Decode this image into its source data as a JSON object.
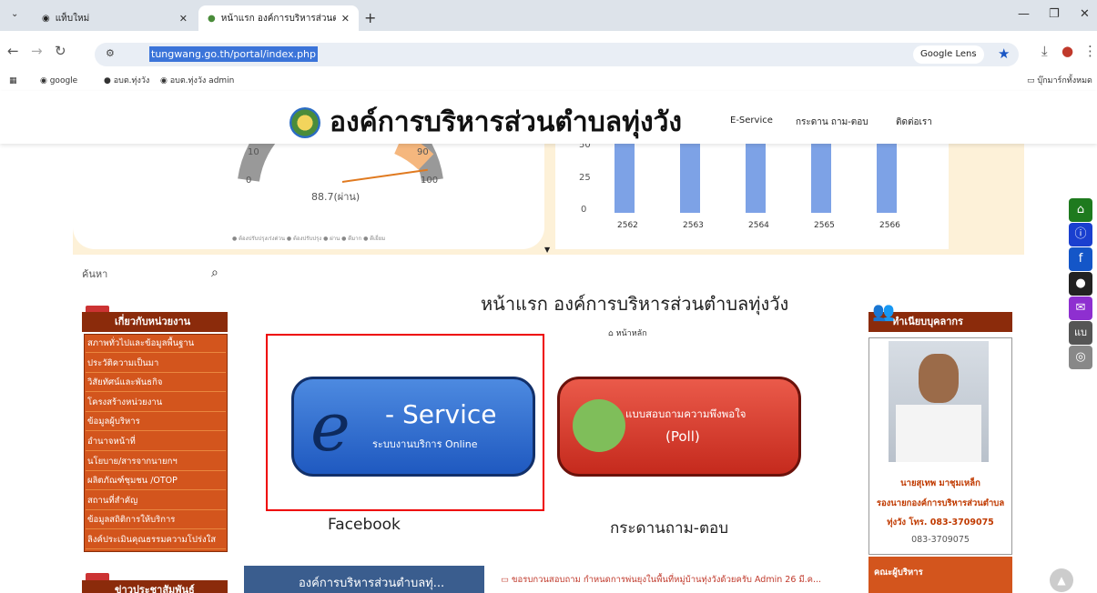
{
  "browser": {
    "tabs": [
      {
        "title": "แท็บใหม่"
      },
      {
        "title": "หน้าแรก องค์การบริหารส่วนตำบลทุ่ง"
      }
    ],
    "url": "tungwang.go.th/portal/index.php",
    "lens_label": "Google Lens",
    "bookmarks": [
      "google",
      "อบต.ทุ่งวัง",
      "อบต.ทุ่งวัง admin"
    ],
    "all_bookmarks": "บุ๊กมาร์กทั้งหมด"
  },
  "header": {
    "site_name": "องค์การบริหารส่วนตำบลทุ่งวัง",
    "menu": [
      "E-Service",
      "กระดาน ถาม-ตอบ",
      "ติดต่อเรา"
    ]
  },
  "gauge": {
    "ticks": [
      "10",
      "90",
      "0",
      "100"
    ],
    "value_label": "88.7(ผ่าน)",
    "value": 88.7,
    "legend": "● ต้องปรับปรุงเร่งด่วน  ● ต้องปรับปรุง  ● ผ่าน  ● ดีมาก  ● ดีเยี่ยม"
  },
  "chart_data": {
    "type": "bar",
    "categories": [
      "2562",
      "2563",
      "2564",
      "2565",
      "2566"
    ],
    "yticks": [
      "0",
      "25",
      "50"
    ],
    "values": [
      80,
      80,
      80,
      80,
      80
    ],
    "ylim": [
      0,
      50
    ]
  },
  "search": {
    "placeholder": "ค้นหา"
  },
  "about": {
    "title": "เกี่ยวกับหน่วยงาน",
    "items": [
      "สภาพทั่วไปและข้อมูลพื้นฐาน",
      "ประวัติความเป็นมา",
      "วิสัยทัศน์และพันธกิจ",
      "โครงสร้างหน่วยงาน",
      "ข้อมูลผู้บริหาร",
      "อำนาจหน้าที่",
      "นโยบาย/สารจากนายกฯ",
      "ผลิตภัณฑ์ชุมชน /OTOP",
      "สถานที่สำคัญ",
      "ข้อมูลสถิติการให้บริการ",
      "ลิงค์ประเมินคุณธรรมความโปร่งใส"
    ]
  },
  "pr_title": "ข่าวประชาสัมพันธ์",
  "main": {
    "title": "หน้าแรก องค์การบริหารส่วนตำบลทุ่งวัง",
    "crumb": "หน้าหลัก",
    "eservice": {
      "big": "- Service",
      "small": "ระบบงานบริการ Online"
    },
    "poll": {
      "line1": "แบบสอบถามความพึงพอใจ",
      "line2": "(Poll)"
    },
    "captions": [
      "Facebook",
      "กระดานถาม-ตอบ"
    ],
    "fb_title": "องค์การบริหารส่วนตำบลทุ่...",
    "news": "ขอรบกวนสอบถาม กำหนดการพ่นยุงในพื้นที่หมู่บ้านทุ่งวังด้วยครับ  Admin  26 มี.ค..."
  },
  "staff": {
    "title": "ทำเนียบบุคลากร",
    "name": "นายสุเทพ มาชุมเหล็ก",
    "position": "รองนายกองค์การบริหารส่วนตำบล",
    "tel": "ทุ่งวัง โทร. 083-3709075",
    "tel2": "083-3709075",
    "exec": "คณะผู้บริหาร"
  },
  "floating": [
    "แบ"
  ]
}
